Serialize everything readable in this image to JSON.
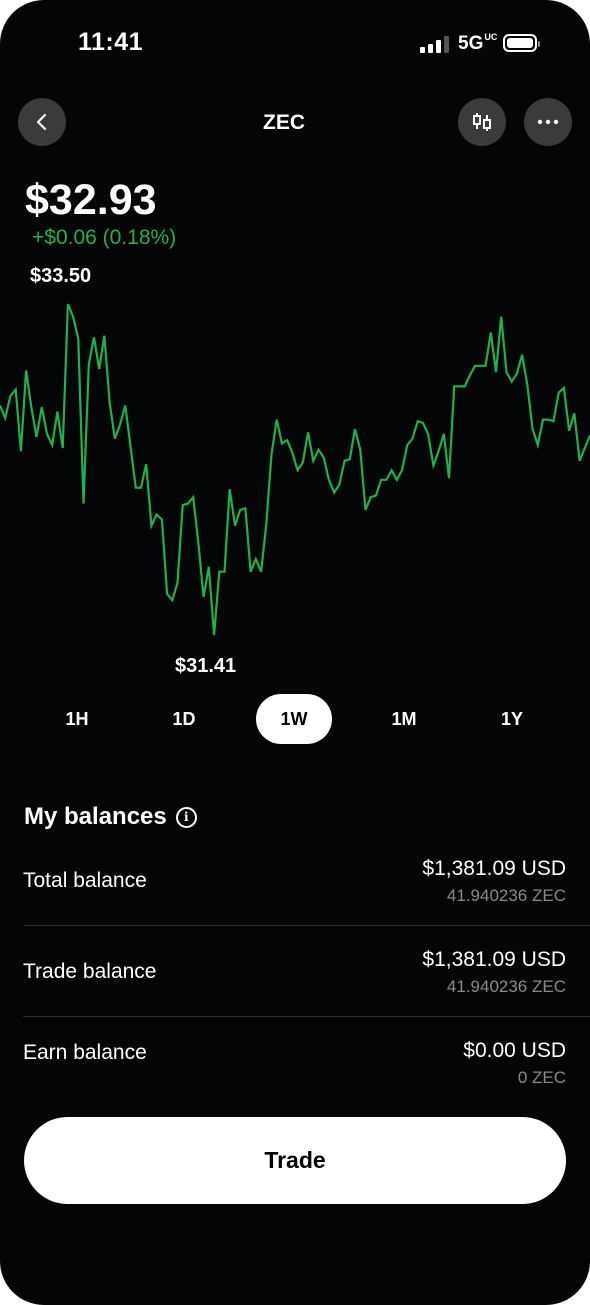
{
  "status_bar": {
    "time": "11:41",
    "network": "5G",
    "network_suffix": "UC",
    "signal_bars": 3,
    "battery_level": 1.0
  },
  "header": {
    "title": "ZEC",
    "back_icon": "chevron-left-icon",
    "chart_type_icon": "candlestick-icon",
    "more_icon": "ellipsis-icon"
  },
  "price": {
    "current": "$32.93",
    "change": "+$0.06 (0.18%)",
    "change_color": "#1fb04f"
  },
  "chart_data": {
    "type": "line",
    "title": "",
    "high_label": "$33.50",
    "low_label": "$31.41",
    "ylim": [
      31.41,
      33.5
    ],
    "grid": false,
    "line_color": "#1fb04f",
    "series": [
      {
        "values": [
          32.86,
          32.78,
          32.92,
          32.96,
          32.57,
          33.08,
          32.85,
          32.66,
          32.85,
          32.68,
          32.61,
          32.82,
          32.59,
          33.5,
          33.42,
          33.28,
          32.24,
          33.12,
          33.29,
          33.09,
          33.3,
          32.88,
          32.65,
          32.74,
          32.86,
          32.6,
          32.34,
          32.34,
          32.49,
          32.1,
          32.17,
          32.14,
          31.67,
          31.63,
          31.74,
          32.23,
          32.24,
          32.28,
          31.99,
          31.65,
          31.84,
          31.41,
          31.81,
          31.81,
          32.33,
          32.1,
          32.2,
          32.21,
          31.81,
          31.89,
          31.81,
          32.11,
          32.55,
          32.77,
          32.62,
          32.64,
          32.56,
          32.45,
          32.5,
          32.69,
          32.51,
          32.58,
          32.53,
          32.39,
          32.31,
          32.36,
          32.51,
          32.52,
          32.71,
          32.58,
          32.2,
          32.28,
          32.29,
          32.39,
          32.39,
          32.45,
          32.39,
          32.45,
          32.61,
          32.65,
          32.76,
          32.75,
          32.68,
          32.48,
          32.57,
          32.68,
          32.4,
          32.98,
          32.98,
          32.98,
          33.05,
          33.11,
          33.11,
          33.11,
          33.32,
          33.07,
          33.42,
          33.07,
          33.01,
          33.06,
          33.18,
          32.99,
          32.71,
          32.61,
          32.77,
          32.77,
          32.76,
          32.94,
          32.97,
          32.7,
          32.81,
          32.51,
          32.59,
          32.67
        ]
      }
    ]
  },
  "timeframes": {
    "items": [
      "1H",
      "1D",
      "1W",
      "1M",
      "1Y"
    ],
    "selected": "1W"
  },
  "balances": {
    "heading": "My balances",
    "info_icon": "info-icon",
    "rows": [
      {
        "label": "Total balance",
        "usd": "$1,381.09 USD",
        "zec": "41.940236 ZEC"
      },
      {
        "label": "Trade balance",
        "usd": "$1,381.09 USD",
        "zec": "41.940236 ZEC"
      },
      {
        "label": "Earn balance",
        "usd": "$0.00 USD",
        "zec": "0 ZEC"
      }
    ]
  },
  "actions": {
    "trade_label": "Trade"
  }
}
